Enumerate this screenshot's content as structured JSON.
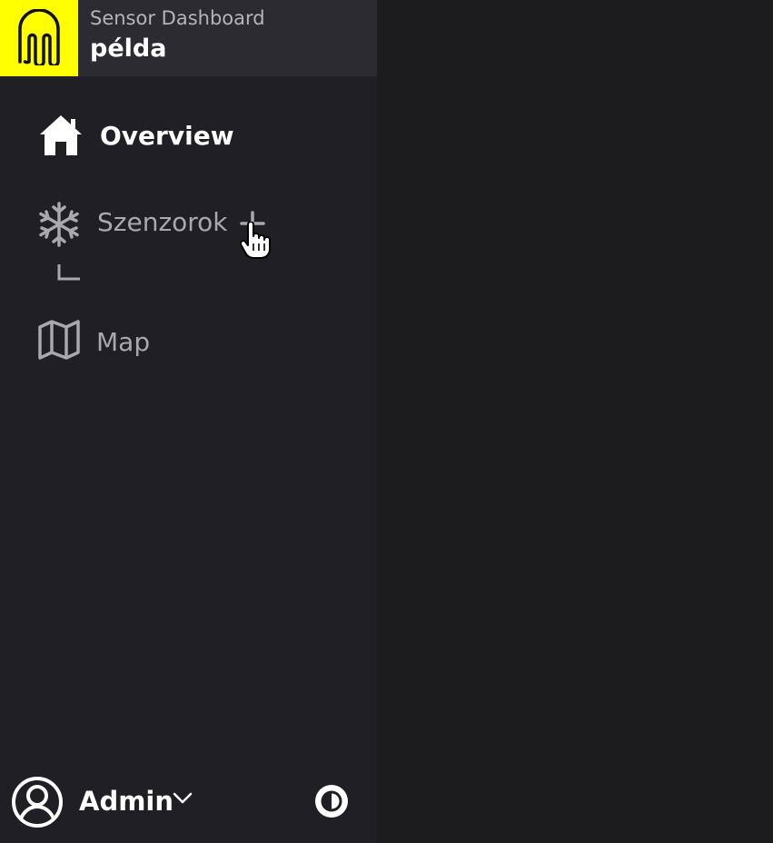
{
  "header": {
    "app_name": "Sensor Dashboard",
    "site_name": "példa"
  },
  "nav": {
    "overview": {
      "label": "Overview",
      "icon": "home-icon"
    },
    "sensors": {
      "label": "Szenzorok",
      "icon": "snowflake-icon",
      "action_icon": "plus-icon"
    },
    "map": {
      "label": "Map",
      "icon": "map-icon"
    }
  },
  "footer": {
    "user_name": "Admin",
    "avatar_icon": "user-circle-icon",
    "menu_icon": "chevron-down-icon",
    "theme_icon": "contrast-toggle-icon"
  },
  "colors": {
    "brand": "#ffff00",
    "sidebar_bg": "#1f1f25",
    "header_bg": "#2b2b31",
    "main_bg": "#1c1c1f",
    "active_text": "#ffffff",
    "inactive_text": "#a8a8ae"
  }
}
